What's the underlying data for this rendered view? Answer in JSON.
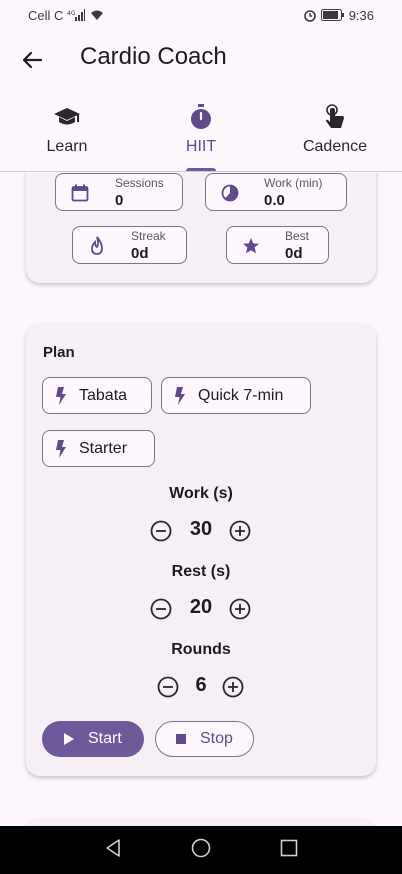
{
  "status_bar": {
    "carrier": "Cell C",
    "network": "4G",
    "time": "9:36",
    "icons": [
      "signal-icon",
      "wifi-icon",
      "alarm-icon",
      "battery-icon"
    ]
  },
  "app_bar": {
    "title": "Cardio Coach",
    "back_icon": "arrow-back-icon"
  },
  "tabs": [
    {
      "label": "Learn",
      "icon": "school-icon",
      "active": false
    },
    {
      "label": "HIIT",
      "icon": "timer-icon",
      "active": true
    },
    {
      "label": "Cadence",
      "icon": "touch-icon",
      "active": false
    }
  ],
  "stats": {
    "sessions": {
      "label": "Sessions",
      "value": "0",
      "icon": "calendar-icon"
    },
    "work": {
      "label": "Work (min)",
      "value": "0.0",
      "icon": "clock-icon"
    },
    "streak": {
      "label": "Streak",
      "value": "0d",
      "icon": "fire-icon"
    },
    "best": {
      "label": "Best",
      "value": "0d",
      "icon": "star-icon"
    }
  },
  "plan": {
    "title": "Plan",
    "presets": [
      {
        "label": "Tabata",
        "icon": "bolt-icon"
      },
      {
        "label": "Quick 7-min",
        "icon": "bolt-icon"
      },
      {
        "label": "Starter",
        "icon": "bolt-icon"
      }
    ],
    "work": {
      "label": "Work (s)",
      "value": "30"
    },
    "rest": {
      "label": "Rest (s)",
      "value": "20"
    },
    "rounds": {
      "label": "Rounds",
      "value": "6"
    },
    "start_label": "Start",
    "stop_label": "Stop"
  },
  "colors": {
    "accent": "#6e5a9a",
    "background": "#fdf7fd",
    "card": "#f6f0f6",
    "outline": "#7a7580"
  }
}
